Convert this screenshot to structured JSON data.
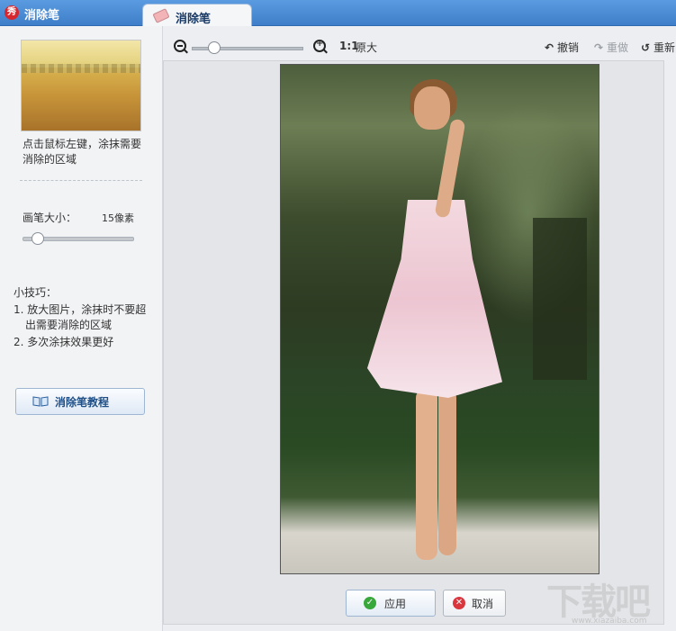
{
  "app": {
    "title": "消除笔",
    "icon": "秀"
  },
  "tab": {
    "label": "消除笔"
  },
  "left": {
    "hint": "点击鼠标左键，涂抹需要消除的区域",
    "brush_label": "画笔大小：",
    "brush_value": "15像素",
    "brush_level": 0.15,
    "tips_title": "小技巧：",
    "tip1": "1. 放大图片，涂抹时不要超",
    "tip1b": "出需要消除的区域",
    "tip2": "2. 多次涂抹效果更好",
    "tutorial": "消除笔教程"
  },
  "toolbar": {
    "one_to_one": "1:1",
    "original_size": "原大",
    "undo": "撤销",
    "redo": "重做",
    "reset": "重新"
  },
  "actions": {
    "apply": "应用",
    "cancel": "取消"
  },
  "watermark": {
    "text": "下载吧",
    "url": "www.xiazaiba.com"
  },
  "colors": {
    "titlebar": "#3f7fc9",
    "apply_icon": "#38a83a",
    "cancel_icon": "#d9363e"
  }
}
